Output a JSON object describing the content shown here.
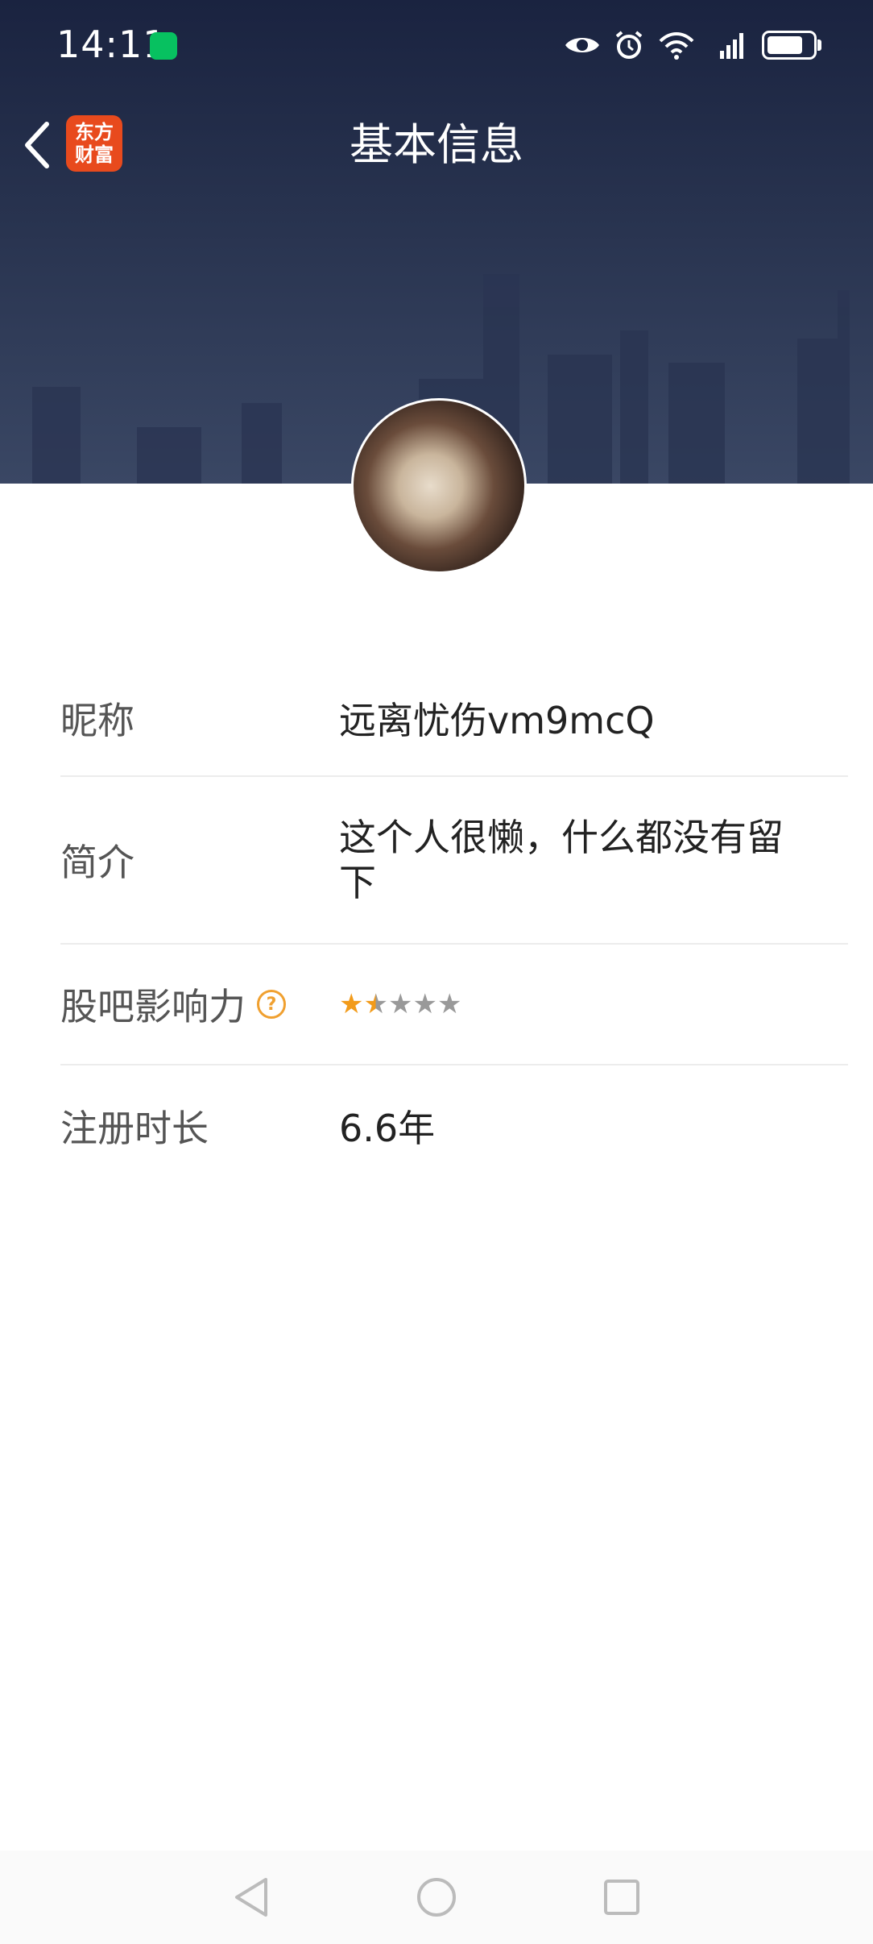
{
  "status_bar": {
    "time": "14:11",
    "icons": [
      "wechat-icon",
      "eye-icon",
      "alarm-icon",
      "wifi-icon",
      "4g-signal-icon",
      "battery-icon"
    ]
  },
  "header": {
    "title": "基本信息",
    "app_logo_line1": "东方",
    "app_logo_line2": "财富"
  },
  "profile": {
    "rows": [
      {
        "label": "昵称",
        "value": "远离忧伤vm9mcQ"
      },
      {
        "label": "简介",
        "value": "这个人很懒，什么都没有留下"
      },
      {
        "label": "股吧影响力",
        "rating": 1.5,
        "rating_max": 5
      },
      {
        "label": "注册时长",
        "value": "6.6年"
      }
    ]
  },
  "colors": {
    "header_bg": "#1a2340",
    "star_active": "#f29b1a",
    "star_inactive": "#999999",
    "help_icon": "#f0a030",
    "logo_bg": "#e84a1d"
  }
}
